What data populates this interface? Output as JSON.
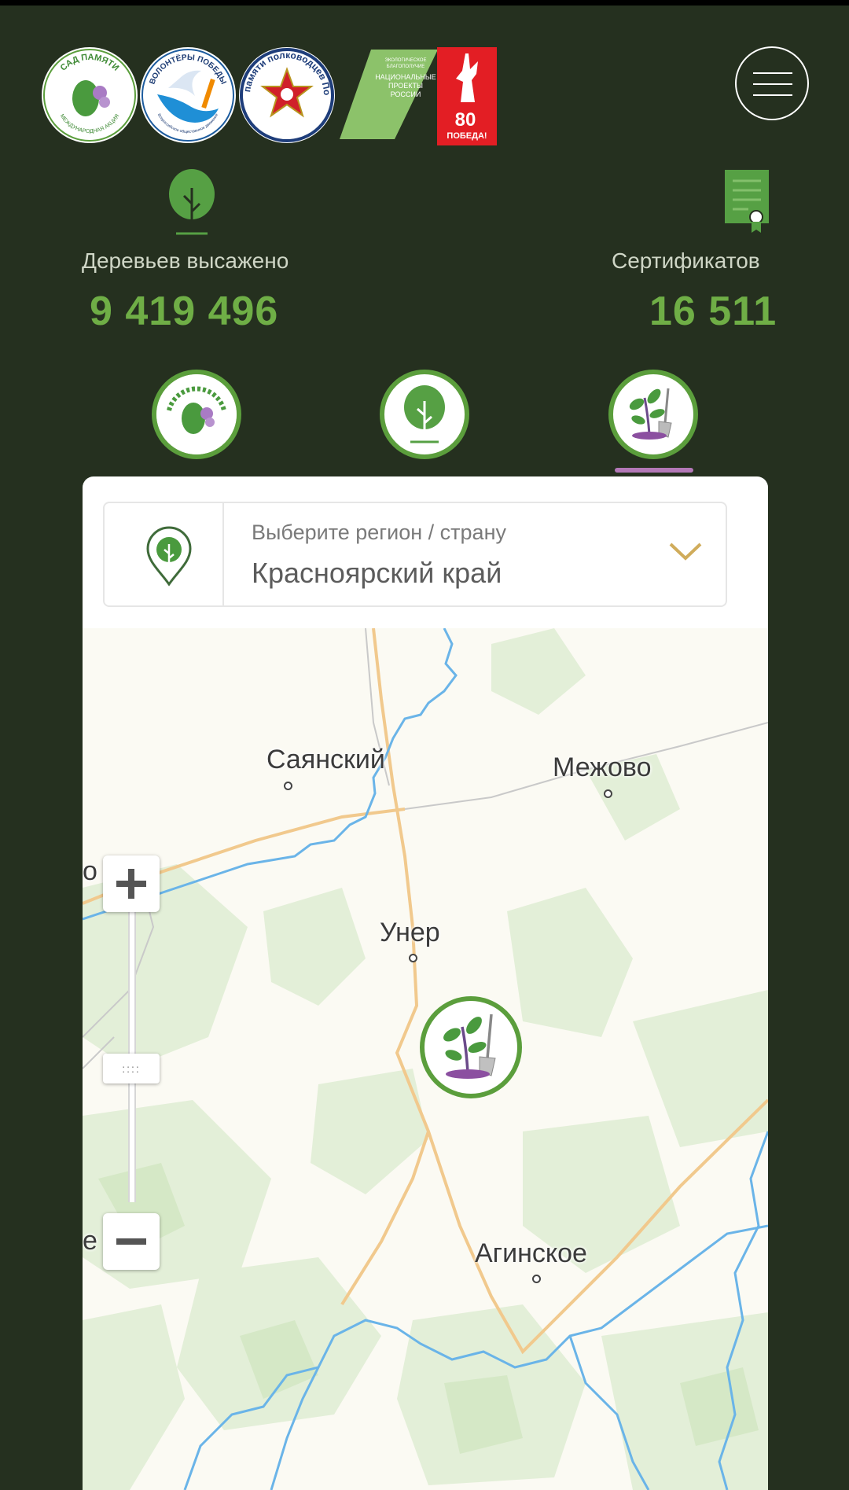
{
  "header": {
    "logos": [
      {
        "name": "sad-pamyati-logo",
        "text_top": "САД ПАМЯТИ",
        "text_bottom": "МЕЖДУНАРОДНАЯ АКЦИЯ"
      },
      {
        "name": "volontery-pobedy-logo",
        "text_top": "ВОЛОНТЁРЫ ПОБЕДЫ",
        "text_bottom": "Всероссийское общественное движение"
      },
      {
        "name": "fond-pamyati-logo",
        "text": "Фонд памяти полководцев Победы"
      },
      {
        "name": "natsproekty-logo",
        "lines": [
          "ЭКОЛОГИЧЕСКОЕ",
          "БЛАГОПОЛУЧИЕ",
          "НАЦИОНАЛЬНЫЕ",
          "ПРОЕКТЫ",
          "РОССИИ"
        ]
      },
      {
        "name": "pobeda-80-logo",
        "number": "80",
        "word": "ПОБЕДА!"
      }
    ],
    "menu_icon": "hamburger-icon"
  },
  "stats": {
    "trees": {
      "label": "Деревьев высажено",
      "value": "9 419 496",
      "icon": "tree-icon"
    },
    "certificates": {
      "label": "Сертификатов",
      "value": "16 511",
      "icon": "certificate-icon"
    }
  },
  "tabs": [
    {
      "name": "tab-sad-pamyati",
      "icon": "sad-pamyati-emblem",
      "active": false
    },
    {
      "name": "tab-trees",
      "icon": "tree-icon",
      "active": false
    },
    {
      "name": "tab-planting",
      "icon": "seedling-shovel-icon",
      "active": true
    }
  ],
  "region_select": {
    "caption": "Выберите регион / страну",
    "value": "Красноярский край",
    "icon": "location-pin-icon",
    "chevron": "chevron-down-icon"
  },
  "map": {
    "places": [
      "Саянский",
      "Межово",
      "Унер",
      "Агинское"
    ],
    "partial_labels": [
      "о",
      "е"
    ],
    "zoom_in": "+",
    "zoom_out": "−",
    "zoom_handle": "::::",
    "marker_icon": "seedling-shovel-icon"
  },
  "colors": {
    "background": "#25301f",
    "accent_green": "#6fae46",
    "tab_underline": "#b378b7",
    "chevron": "#d0ac5b",
    "river": "#6ab4e8",
    "road": "#f1c98d"
  }
}
